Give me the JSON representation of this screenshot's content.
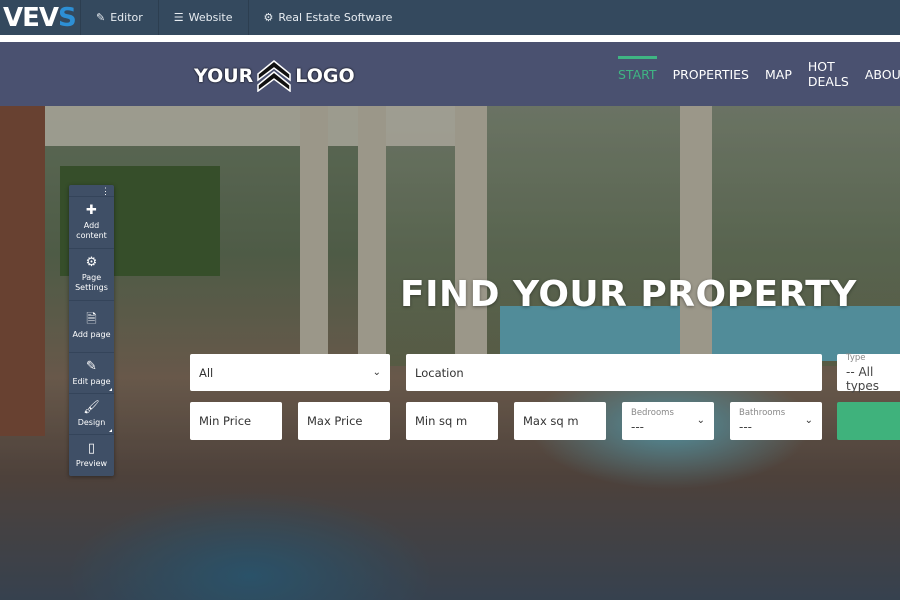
{
  "topbar": {
    "brand": "VEV",
    "brand_accent": "S",
    "items": [
      {
        "icon": "pencil-icon",
        "glyph": "✎",
        "label": "Editor"
      },
      {
        "icon": "list-icon",
        "glyph": "☰",
        "label": "Website"
      },
      {
        "icon": "gear-icon",
        "glyph": "⚙",
        "label": "Real Estate Software"
      }
    ]
  },
  "site": {
    "logo_left": "YOUR",
    "logo_right": "LOGO",
    "nav": [
      {
        "label": "START",
        "active": true
      },
      {
        "label": "PROPERTIES"
      },
      {
        "label": "MAP"
      },
      {
        "label": "HOT DEALS"
      },
      {
        "label": "ABOUT"
      }
    ],
    "colors": {
      "header": "#4a5170",
      "accent": "#3fb583"
    }
  },
  "hero": {
    "headline": "FIND YOUR PROPERTY"
  },
  "search": {
    "category": "All",
    "location_placeholder": "Location",
    "type": {
      "label": "Type",
      "value": "-- All types"
    },
    "min_price": "Min Price",
    "max_price": "Max Price",
    "min_sqm": "Min sq m",
    "max_sqm": "Max sq m",
    "bedrooms": {
      "label": "Bedrooms",
      "value": "---"
    },
    "bathrooms": {
      "label": "Bathrooms",
      "value": "---"
    }
  },
  "panel": {
    "items": [
      {
        "icon": "plus-icon",
        "glyph": "✚",
        "label": "Add content"
      },
      {
        "icon": "cogs-icon",
        "glyph": "⚙",
        "label": "Page Settings"
      },
      {
        "icon": "file-icon",
        "glyph": "🗎",
        "label": "Add page"
      },
      {
        "icon": "pencil-icon",
        "glyph": "✎",
        "label": "Edit page"
      },
      {
        "icon": "brush-icon",
        "glyph": "🖌",
        "label": "Design"
      },
      {
        "icon": "mobile-icon",
        "glyph": "▯",
        "label": "Preview"
      }
    ]
  }
}
